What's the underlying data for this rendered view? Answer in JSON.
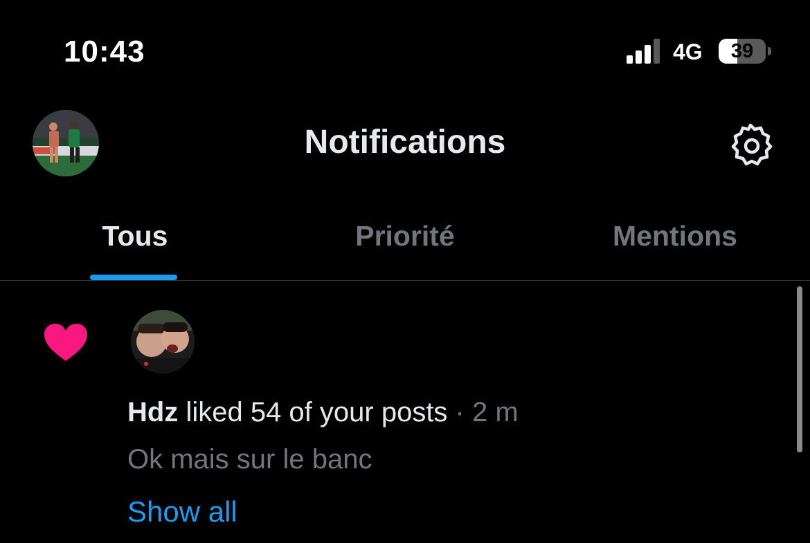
{
  "status_bar": {
    "time": "10:43",
    "network": "4G",
    "battery_level": "39",
    "battery_fraction": 0.39
  },
  "header": {
    "title": "Notifications",
    "profile_avatar": "profile-avatar",
    "settings_icon": "gear-icon"
  },
  "tabs": [
    {
      "label": "Tous",
      "active": true
    },
    {
      "label": "Priorité",
      "active": false
    },
    {
      "label": "Mentions",
      "active": false
    }
  ],
  "notification": {
    "icon": "heart-icon",
    "icon_color": "#f91880",
    "user": "Hdz",
    "action": " liked 54 of your posts",
    "time": " · 2 m",
    "snippet": "Ok mais sur le banc",
    "show_all": "Show all"
  },
  "colors": {
    "background": "#000000",
    "accent": "#1d9bf0",
    "primary_text": "#e7e9ea",
    "secondary_text": "#71767b",
    "like": "#f91880"
  }
}
